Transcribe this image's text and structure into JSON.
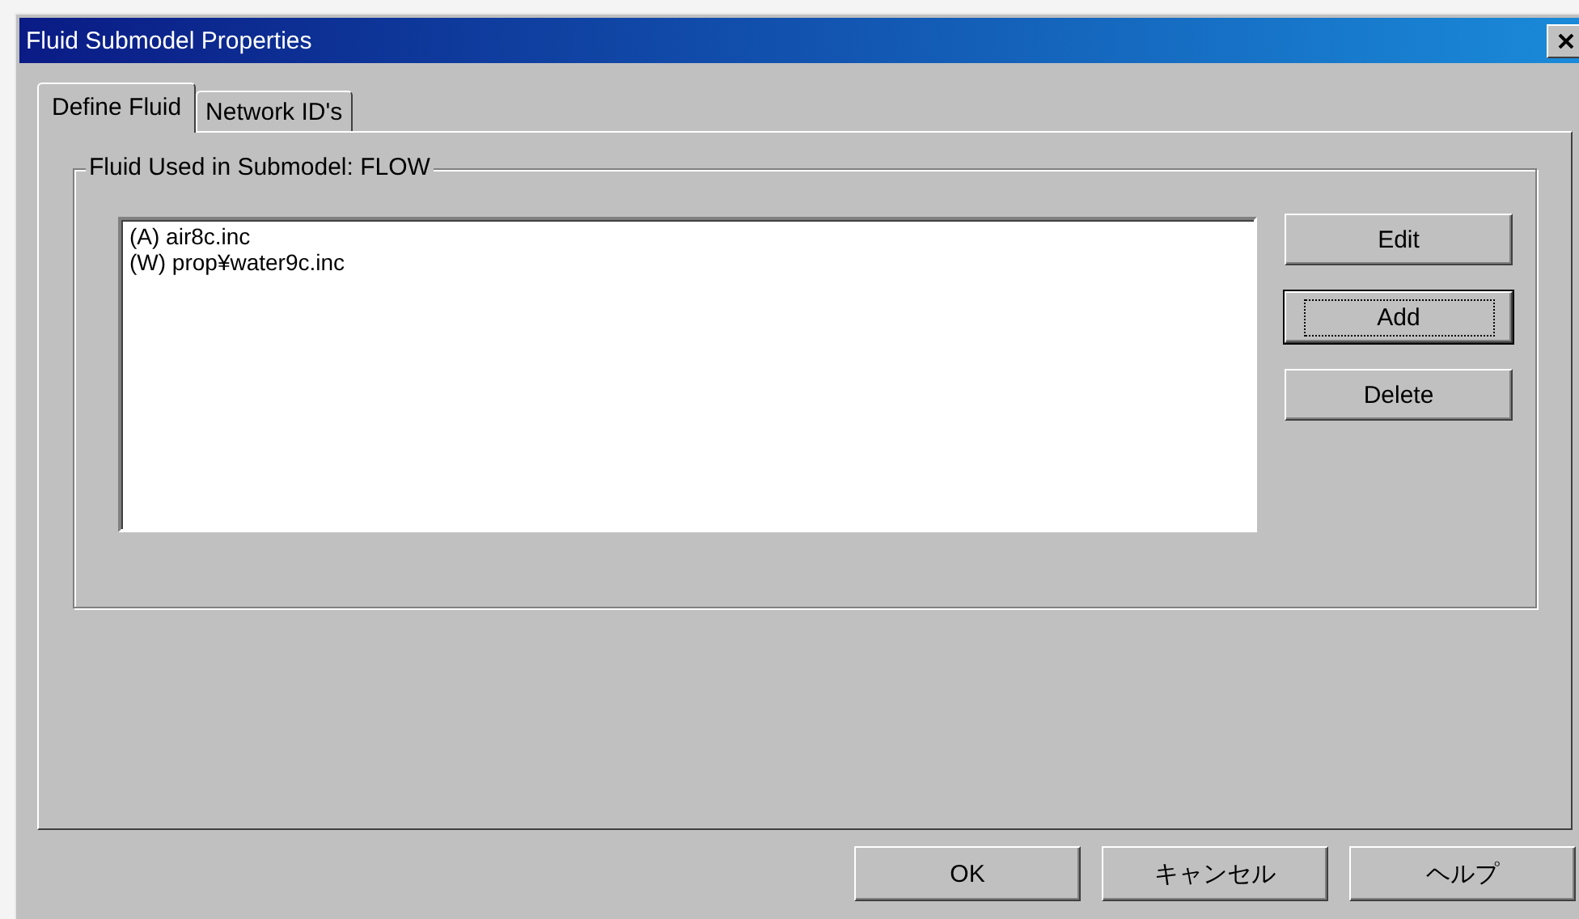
{
  "window": {
    "title": "Fluid Submodel Properties"
  },
  "tabs": [
    {
      "label": "Define Fluid",
      "selected": true
    },
    {
      "label": "Network ID's",
      "selected": false
    }
  ],
  "group": {
    "title": "Fluid Used in Submodel: FLOW"
  },
  "fluids": [
    {
      "label": "(A) air8c.inc"
    },
    {
      "label": "(W) prop¥water9c.inc"
    }
  ],
  "side_buttons": [
    {
      "label": "Edit",
      "default": false
    },
    {
      "label": "Add",
      "default": true
    },
    {
      "label": "Delete",
      "default": false
    }
  ],
  "buttons": [
    {
      "label": "OK"
    },
    {
      "label": "キャンセル"
    },
    {
      "label": "ヘルプ"
    }
  ]
}
